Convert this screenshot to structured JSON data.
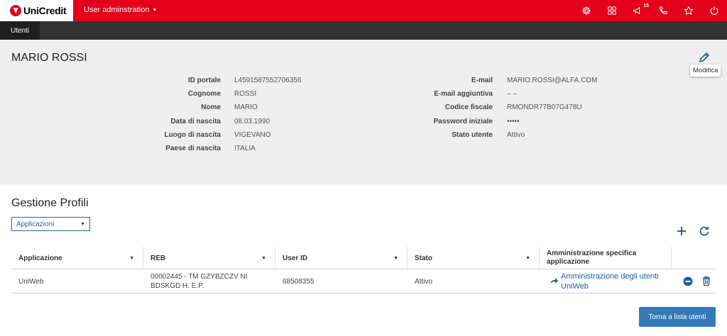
{
  "brand": {
    "name": "UniCredit",
    "accent": "#e2001a",
    "dark_bar": "#333333",
    "primary": "#337ab7"
  },
  "topbar": {
    "app_menu_label": "User adminstration",
    "icons": [
      "gear-icon",
      "apps-grid-icon",
      "megaphone-icon",
      "phone-icon",
      "star-icon",
      "power-icon"
    ],
    "notification_count": "15"
  },
  "tabs": [
    {
      "label": "Utenti"
    }
  ],
  "user": {
    "full_name": "MARIO ROSSI",
    "edit_tooltip": "Modifica",
    "left_fields": [
      {
        "label": "ID portale",
        "value": "L4591587552706356"
      },
      {
        "label": "Cognome",
        "value": "ROSSI"
      },
      {
        "label": "Nome",
        "value": "MARIO"
      },
      {
        "label": "Data di nascita",
        "value": "08.03.1990"
      },
      {
        "label": "Luogo di nascita",
        "value": "VIGEVANO"
      },
      {
        "label": "Paese di nascita",
        "value": "ITALIA"
      }
    ],
    "right_fields": [
      {
        "label": "E-mail",
        "value": "MARIO.ROSSI@ALFA.COM"
      },
      {
        "label": "E-mail aggiuntiva",
        "value": "– –"
      },
      {
        "label": "Codice fiscale",
        "value": "RMONDR77B07G478U"
      },
      {
        "label": "Password iniziale",
        "value": "•••••"
      },
      {
        "label": "Stato utente",
        "value": "Attivo"
      }
    ]
  },
  "profiles": {
    "title": "Gestione Profili",
    "select_value": "Applicazioni",
    "columns": [
      "Applicazione",
      "REB",
      "User ID",
      "Stato",
      "Amministrazione specifica applicazione"
    ],
    "rows": [
      {
        "applicazione": "UniWeb",
        "reb": "00002445 - TM GZYBZCZV NI BDSKGD H. E.P.",
        "user_id": "68508355",
        "stato": "Attivo",
        "admin_link": "Amministrazione degli utenti UniWeb"
      }
    ]
  },
  "footer": {
    "back_button": "Torna a lista utenti"
  }
}
